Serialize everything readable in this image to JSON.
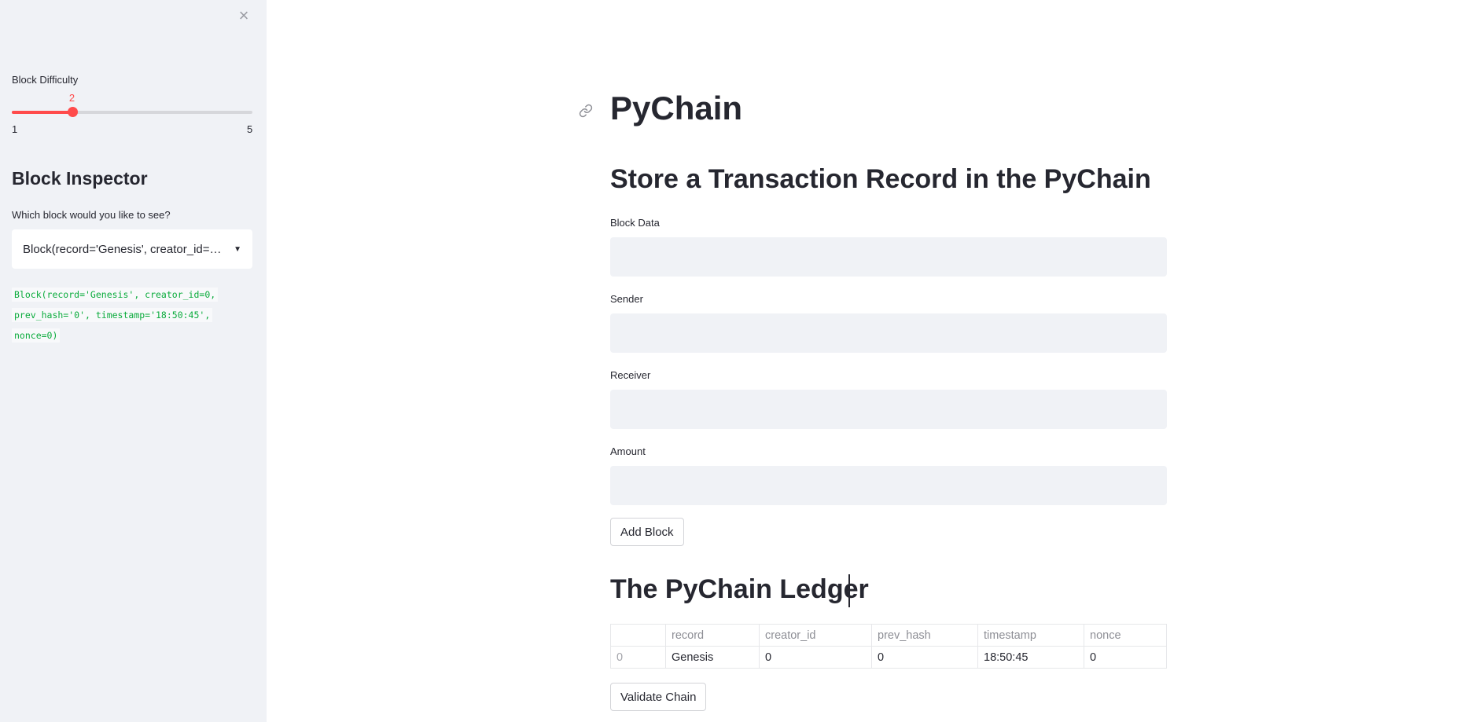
{
  "sidebar": {
    "close_icon": "×",
    "difficulty": {
      "label": "Block Difficulty",
      "value": 2,
      "value_text": "2",
      "min": 1,
      "max": 5,
      "min_text": "1",
      "max_text": "5"
    },
    "inspector": {
      "heading": "Block Inspector",
      "select_label": "Which block would you like to see?",
      "selected_value": "Block(record='Genesis', creator_id=0, prev_hash='0', timestamp='18:50:45', nonce=0)",
      "code_lines": [
        "Block(record='Genesis', creator_id=0,",
        "prev_hash='0', timestamp='18:50:45',",
        "nonce=0)"
      ]
    }
  },
  "main": {
    "title": "PyChain",
    "store_heading": "Store a Transaction Record in the PyChain",
    "fields": {
      "block_data": {
        "label": "Block Data",
        "value": ""
      },
      "sender": {
        "label": "Sender",
        "value": ""
      },
      "receiver": {
        "label": "Receiver",
        "value": ""
      },
      "amount": {
        "label": "Amount",
        "value": ""
      }
    },
    "add_block_label": "Add Block",
    "ledger_heading": "The PyChain Ledger",
    "ledger": {
      "columns": [
        "",
        "record",
        "creator_id",
        "prev_hash",
        "timestamp",
        "nonce"
      ],
      "rows": [
        [
          "0",
          "Genesis",
          "0",
          "0",
          "18:50:45",
          "0"
        ]
      ]
    },
    "validate_label": "Validate Chain"
  },
  "colors": {
    "accent": "#ff4b4b",
    "sidebar_bg": "#f0f2f6",
    "code_green": "#09ab3b"
  },
  "icons": {
    "close": "close-icon",
    "link": "link-icon",
    "caret": "chevron-down-icon"
  }
}
